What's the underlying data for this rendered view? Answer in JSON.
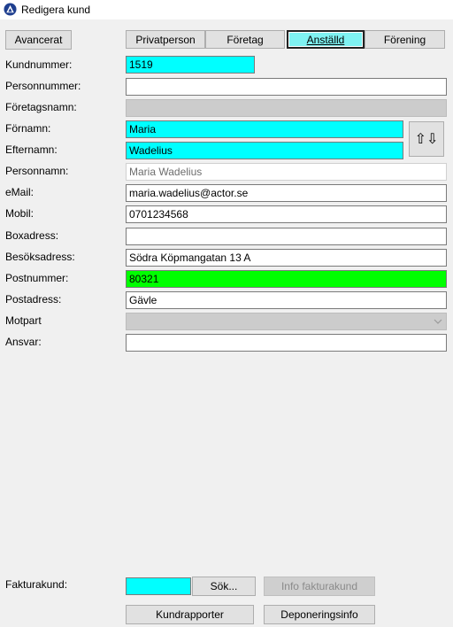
{
  "window": {
    "title": "Redigera kund"
  },
  "buttons": {
    "advanced": "Avancerat",
    "swap": "⇧⇩",
    "search": "Sök...",
    "invoice_info": "Info fakturakund",
    "customer_reports": "Kundrapporter",
    "deposit_info": "Deponeringsinfo"
  },
  "tabs": [
    {
      "label": "Privatperson"
    },
    {
      "label": "Företag"
    },
    {
      "label": "Anställd",
      "active": true
    },
    {
      "label": "Förening"
    }
  ],
  "fields": {
    "customer_number": {
      "label": "Kundnummer:",
      "value": "1519"
    },
    "personal_number": {
      "label": "Personnummer:",
      "value": ""
    },
    "company_name": {
      "label": "Företagsnamn:",
      "value": ""
    },
    "first_name": {
      "label": "Förnamn:",
      "value": "Maria"
    },
    "last_name": {
      "label": "Efternamn:",
      "value": "Wadelius"
    },
    "person_name": {
      "label": "Personnamn:",
      "value": "Maria  Wadelius"
    },
    "email": {
      "label": "eMail:",
      "value": "maria.wadelius@actor.se"
    },
    "mobile": {
      "label": "Mobil:",
      "value": "0701234568"
    },
    "box_address": {
      "label": "Boxadress:",
      "value": ""
    },
    "visit_address": {
      "label": "Besöksadress:",
      "value": "Södra Köpmangatan 13 A"
    },
    "postal_code": {
      "label": "Postnummer:",
      "value": "80321"
    },
    "postal_address": {
      "label": "Postadress:",
      "value": "Gävle"
    },
    "counterparty": {
      "label": "Motpart",
      "value": ""
    },
    "responsibility": {
      "label": "Ansvar:",
      "value": ""
    },
    "invoice_customer": {
      "label": "Fakturakund:",
      "value": ""
    }
  },
  "colors": {
    "highlight_cyan": "#00ffff",
    "highlight_green": "#00ff00",
    "active_tab": "#7ff2f2"
  }
}
